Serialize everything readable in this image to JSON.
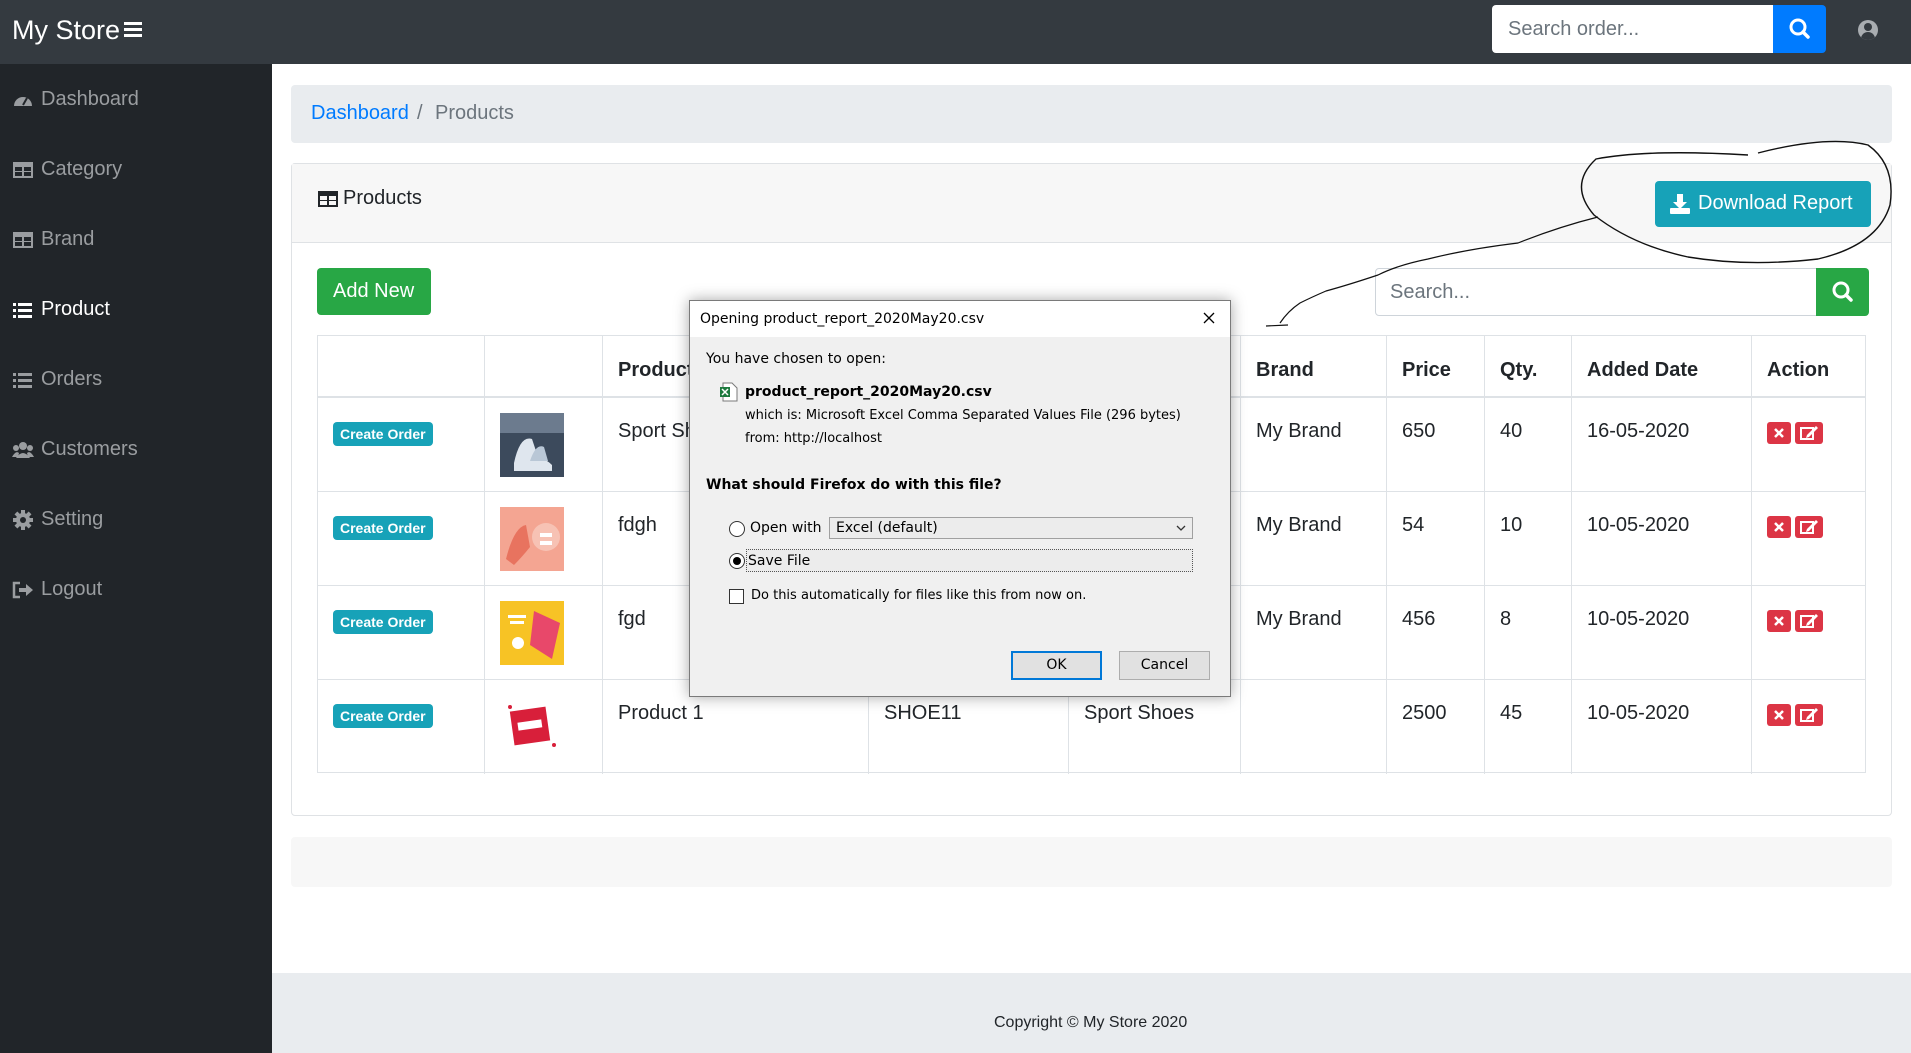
{
  "app": {
    "brand": "My Store"
  },
  "header": {
    "search_placeholder": "Search order..."
  },
  "sidebar": {
    "items": [
      {
        "label": "Dashboard",
        "icon": "dashboard-icon",
        "active": false
      },
      {
        "label": "Category",
        "icon": "table-icon",
        "active": false
      },
      {
        "label": "Brand",
        "icon": "table-icon",
        "active": false
      },
      {
        "label": "Product",
        "icon": "list-icon",
        "active": true
      },
      {
        "label": "Orders",
        "icon": "list-icon",
        "active": false
      },
      {
        "label": "Customers",
        "icon": "users-icon",
        "active": false
      },
      {
        "label": "Setting",
        "icon": "gear-icon",
        "active": false
      },
      {
        "label": "Logout",
        "icon": "sign-out-icon",
        "active": false
      }
    ]
  },
  "breadcrumb": {
    "home": "Dashboard",
    "separator": "/",
    "current": "Products"
  },
  "card": {
    "title": "Products",
    "download_label": "Download Report",
    "add_label": "Add New",
    "search_placeholder": "Search..."
  },
  "table": {
    "headers": [
      "",
      "",
      "Product",
      "",
      "",
      "Brand",
      "Price",
      "Qty.",
      "Added Date",
      "Action"
    ],
    "rows": [
      {
        "action_badge": "Create Order",
        "product": "Sport Sh",
        "code": "",
        "category": "",
        "brand": "My Brand",
        "price": "650",
        "qty": "40",
        "date": "16-05-2020"
      },
      {
        "action_badge": "Create Order",
        "product": "fdgh",
        "code": "",
        "category": "",
        "brand": "My Brand",
        "price": "54",
        "qty": "10",
        "date": "10-05-2020"
      },
      {
        "action_badge": "Create Order",
        "product": "fgd",
        "code": "",
        "category": "",
        "brand": "My Brand",
        "price": "456",
        "qty": "8",
        "date": "10-05-2020"
      },
      {
        "action_badge": "Create Order",
        "product": "Product 1",
        "code": "SHOE11",
        "category": "Sport Shoes",
        "brand": "",
        "price": "2500",
        "qty": "45",
        "date": "10-05-2020"
      }
    ]
  },
  "footer": {
    "copyright": "Copyright © My Store 2020"
  },
  "dialog": {
    "title": "Opening product_report_2020May20.csv",
    "intro": "You have chosen to open:",
    "filename": "product_report_2020May20.csv",
    "which_is": "which is:  Microsoft Excel Comma Separated Values File (296 bytes)",
    "from": "from:  http://localhost",
    "question": "What should Firefox do with this file?",
    "open_with_label": "Open with",
    "open_with_value": "Excel (default)",
    "save_file_label": "Save File",
    "auto_label": "Do this automatically for files like this from now on.",
    "ok_label": "OK",
    "cancel_label": "Cancel"
  },
  "colors": {
    "topbar": "#343a40",
    "sidebar": "#212529",
    "primary": "#007bff",
    "success": "#28a745",
    "info": "#17a2b8",
    "danger": "#dc3545"
  }
}
